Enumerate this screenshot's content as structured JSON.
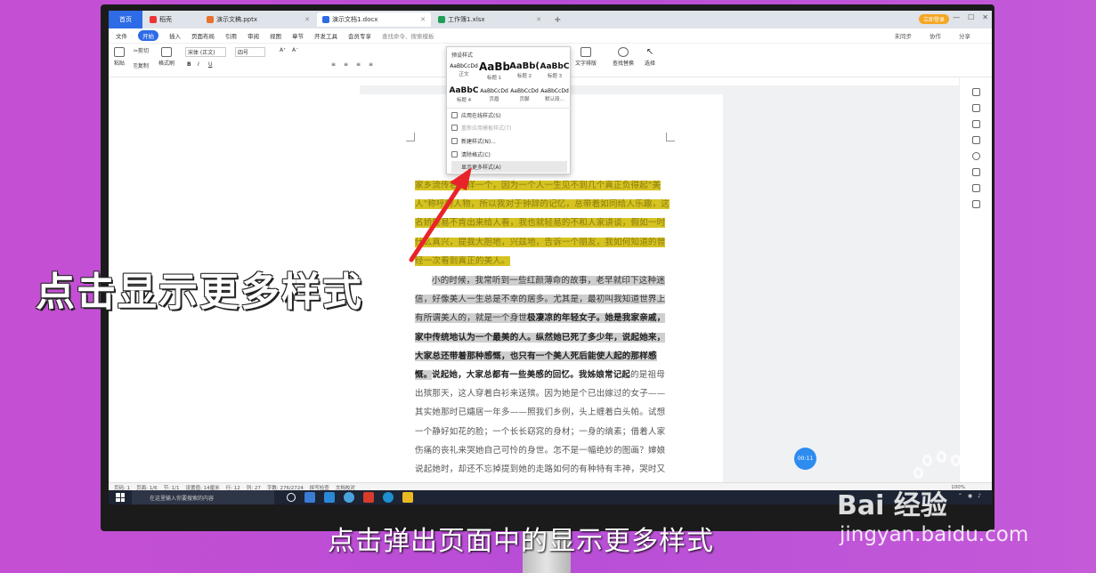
{
  "tabs": [
    {
      "label": "首页"
    },
    {
      "label": "稻壳"
    },
    {
      "label": "演示文稿.pptx"
    },
    {
      "label": "演示文档1.docx"
    },
    {
      "label": "工作簿1.xlsx"
    }
  ],
  "login_label": "立即登录",
  "menu": {
    "items": [
      "文件",
      "开始",
      "插入",
      "页面布局",
      "引用",
      "审阅",
      "视图",
      "章节",
      "开发工具",
      "会员专享"
    ],
    "search": "查找命令、搜索模板",
    "right": [
      "未同步",
      "协作",
      "分享"
    ]
  },
  "ribbon": {
    "paste": "粘贴",
    "cut": "剪切",
    "copy": "复制",
    "format_painter": "格式刷",
    "font_name": "宋体 (正文)",
    "font_size": "四号",
    "text_tools": "文字排版",
    "find_replace": "查找替换",
    "select": "选择"
  },
  "styles_menu": {
    "title": "预设样式",
    "styles": [
      {
        "sample": "AaBbCcDd",
        "label": "正文"
      },
      {
        "sample": "AaBb",
        "label": "标题 1"
      },
      {
        "sample": "AaBb(",
        "label": "标题 2"
      },
      {
        "sample": "AaBbC",
        "label": "标题 3"
      },
      {
        "sample": "AaBbC",
        "label": "标题 4"
      },
      {
        "sample": "AaBbCcDd",
        "label": "页眉"
      },
      {
        "sample": "AaBbCcDd",
        "label": "页脚"
      },
      {
        "sample": "AaBbCcDd",
        "label": "默认段..."
      }
    ],
    "items": [
      {
        "label": "应用在线样式(S)"
      },
      {
        "label": "重新应用模板样式(T)"
      },
      {
        "label": "新建样式(N)..."
      },
      {
        "label": "清除格式(C)"
      },
      {
        "label": "显示更多样式(A)"
      }
    ]
  },
  "document": {
    "para1": "家乡流传着这样一个，因为一个人一生见不到几个真正负得起\"美人\"称呼的人物，所以我对于钟辞的记忆，总带着如同给人乐趣，这名娇轻易不肯出来给人看，我也就轻易的不和人家讲谈，假如一时什么真兴，提我大胆地，兴兹地，告诉一个朋友，我如何知道的曾经一次看到真正的美人。",
    "para2_plain": "小的时候，我常听到一些红颜薄命的故事，老早就印下这种迷信，好像美人一生总是不幸的居多。尤其是，最初叫我知道世界上有所谓美人的，就是一个身世",
    "para2_bold": "极凄凉的年轻女子。她是我家亲戚，家中传统地认为一个最美的人。纵然她已死了多少年，说起她来，大家总还带着那种感慨，也只有一个美人死后能使人起的那样感慨。",
    "para3_bold": "说起她，大家总都有一些美感的回忆。我姊娘常记起",
    "para3_plain": "的是祖母出殡那天，这人穿着白衫来送殡。因为她是个已出嫁过的女子——其实她那时已孀居一年多——照我们乡例，头上缠着白头帕。试想一个静好如花的脸；一个长长窈窕的身材；一身的缟素；借着人家伤痛的丧礼来哭她自己可怜的身世。怎不是一幅绝妙的图画？婶娘说起她时，却还不忘掉提到她的走路如何的有种特有丰神，哭时又如何的辛酸凄"
  },
  "status": {
    "page": "页码: 1",
    "pages": "页面: 1/6",
    "section": "节: 1/1",
    "setting": "设置值: 14厘米",
    "row": "行: 12",
    "col": "列: 27",
    "words": "字数: 276/2724",
    "spell": "拼写检查",
    "proof": "文档校对",
    "zoom": "100%"
  },
  "taskbar": {
    "search": "在这里输入你要搜索的内容"
  },
  "timer": "00:11",
  "caption": "点击显示更多样式",
  "subtitle": "点击弹出页面中的显示更多样式",
  "watermark": {
    "brand": "Bai 经验",
    "url": "jingyan.baidu.com"
  },
  "colors": {
    "accent": "#2e6be6",
    "highlight_yellow": "#d6c221",
    "arrow": "#e8232a"
  }
}
